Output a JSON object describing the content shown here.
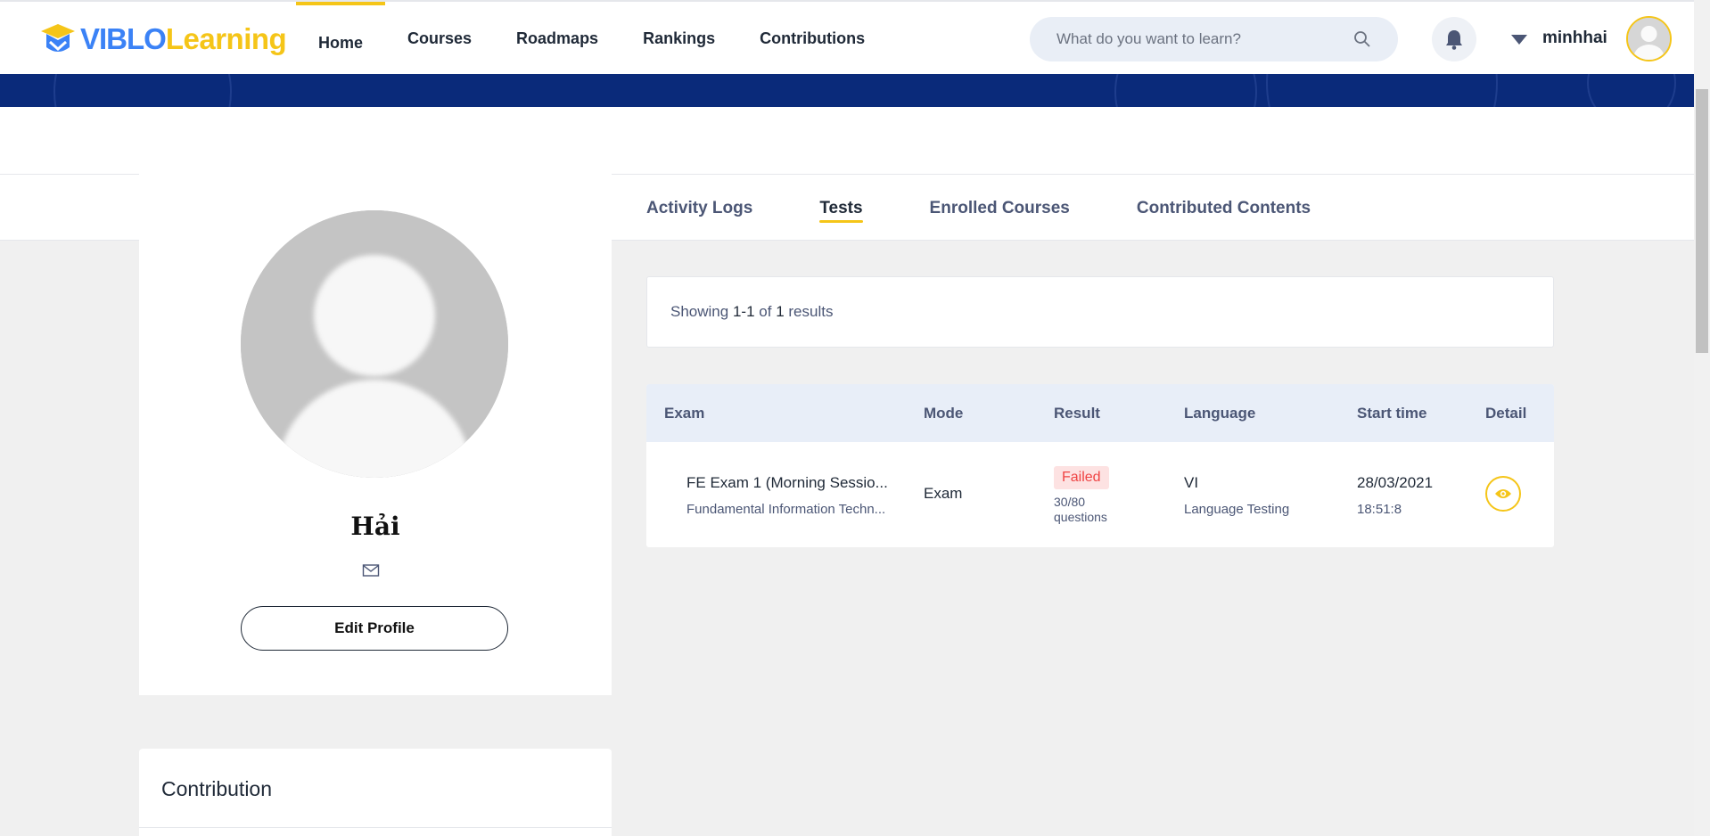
{
  "brand": {
    "viblo": "VIBLO",
    "learning": "Learning"
  },
  "nav": [
    {
      "label": "Home",
      "active": true
    },
    {
      "label": "Courses"
    },
    {
      "label": "Roadmaps"
    },
    {
      "label": "Rankings"
    },
    {
      "label": "Contributions"
    }
  ],
  "search": {
    "placeholder": "What do you want to learn?"
  },
  "user": {
    "name": "minhhai"
  },
  "profile": {
    "name": "Hải",
    "edit_label": "Edit Profile"
  },
  "contribution": {
    "title": "Contribution"
  },
  "tabs": [
    {
      "label": "Activity Logs"
    },
    {
      "label": "Tests",
      "active": true
    },
    {
      "label": "Enrolled Courses"
    },
    {
      "label": "Contributed Contents"
    }
  ],
  "results": {
    "prefix": "Showing",
    "range": "1-1",
    "of": "of",
    "total": "1",
    "suffix": "results"
  },
  "table": {
    "headers": [
      "Exam",
      "Mode",
      "Result",
      "Language",
      "Start time",
      "Detail"
    ],
    "rows": [
      {
        "exam_title": "FE Exam 1 (Morning Sessio...",
        "exam_subtitle": "Fundamental Information Techn...",
        "mode": "Exam",
        "result_status": "Failed",
        "result_score": "30/80",
        "result_unit": "questions",
        "language": "VI",
        "language_sub": "Language Testing",
        "start_date": "28/03/2021",
        "start_time": "18:51:8"
      }
    ]
  },
  "colors": {
    "accent": "#f5c518",
    "brand_blue": "#3b82f6",
    "banner": "#0a2a7a",
    "failed": "#ef4444"
  }
}
